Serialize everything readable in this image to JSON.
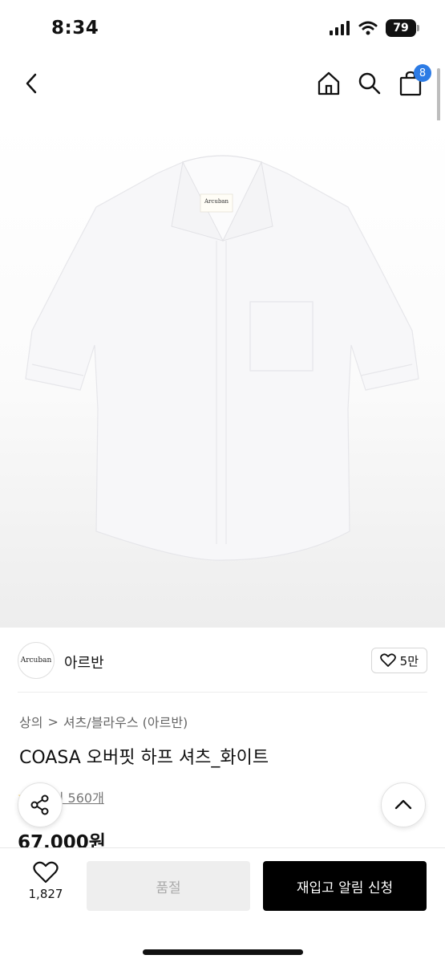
{
  "status_bar": {
    "time": "8:34",
    "battery": "79"
  },
  "header": {
    "cart_count": "8"
  },
  "product_image": {
    "label_text": "Arcuban"
  },
  "brand": {
    "logo_text": "Arcuban",
    "name": "아르반",
    "likes": "5만"
  },
  "breadcrumb": {
    "level1": "상의",
    "separator": ">",
    "level2": "셔츠/블라우스 (아르반)"
  },
  "product": {
    "title": "COASA 오버핏 하프 셔츠_화이트",
    "reviews": "후기 560개",
    "price": "67,000원"
  },
  "bottom_bar": {
    "wish_count": "1,827",
    "soldout_label": "품절",
    "restock_label": "재입고 알림 신청"
  },
  "colors": {
    "accent": "#2c7be5",
    "primary_button": "#000000",
    "disabled_button": "#eeeeee"
  }
}
